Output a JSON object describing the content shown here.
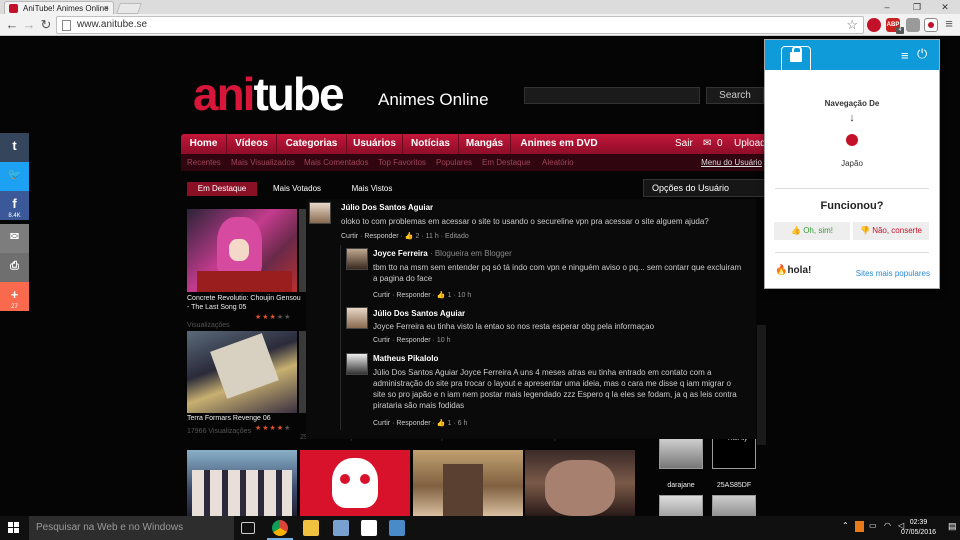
{
  "browser": {
    "tab_title": "AniTube! Animes Online",
    "url": "www.anitube.se",
    "win_min": "–",
    "win_max": "❐",
    "win_close": "✕",
    "ext_abp": "ABP",
    "ext_abp_count": "4",
    "ext_hola_badge": "JP"
  },
  "site": {
    "logo_ani": "ani",
    "logo_tube": "tube",
    "logo_subtitle": "Animes Online",
    "search_button": "Search",
    "nav": [
      "Home",
      "Vídeos",
      "Categorias",
      "Usuários",
      "Notícias",
      "Mangás",
      "Animes em DVD"
    ],
    "nav_sair": "Sair",
    "nav_upload_count": "0",
    "nav_upload": "Upload",
    "subnav": [
      "Recentes",
      "Mais Visualizados",
      "Mais Comentados",
      "Top Favoritos",
      "Populares",
      "Em Destaque",
      "Aleatório"
    ],
    "subnav_right": "Menu do Usuário",
    "filter_tabs": [
      "Em Destaque",
      "Mais Votados",
      "Mais Vistos"
    ],
    "options_title": "Opções do Usuário",
    "videos": [
      {
        "title": "Concrete Revolutio: Choujin Gensou - The Last Song 05",
        "views": "Visualizações",
        "rating": 3
      },
      {
        "title": "Terra Formars Revenge 06",
        "views": "17966 Visualizações",
        "rating": 4
      },
      {
        "title": "",
        "views": "29689 Visualizações",
        "rating": 5
      },
      {
        "title": "",
        "views": "Visualizações",
        "rating": 0
      }
    ],
    "side_users": [
      {
        "name": "darajane"
      },
      {
        "name": "25AS85DF"
      }
    ],
    "side_thumb_label": "ThePify"
  },
  "comments": [
    {
      "name": "Júlio Dos Santos Aguiar",
      "tag": "",
      "text": "oloko to com problemas em acessar o site to usando o secureline vpn pra acessar o site alguem ajuda?",
      "like": "Curtir",
      "reply": "Responder",
      "likes": "2",
      "time": "11 h",
      "edited": "Editado"
    },
    {
      "name": "Joyce Ferreira",
      "tag": "Blogueira em Blogger",
      "text": "tbm tto na msm sem entender pq só tá indo com vpn e ninguém aviso o pq... sem contarr que excluiram a pagina do face",
      "like": "Curtir",
      "reply": "Responder",
      "likes": "1",
      "time": "10 h"
    },
    {
      "name": "Júlio Dos Santos Aguiar",
      "tag": "",
      "text": "Joyce Ferreira eu tinha visto la entao so nos resta esperar obg pela informaçao",
      "like": "Curtir",
      "reply": "Responder",
      "likes": "",
      "time": "10 h"
    },
    {
      "name": "Matheus Pikalolo",
      "tag": "",
      "text": "Júlio Dos Santos Aguiar Joyce Ferreira A uns 4 meses atras eu tinha entrado em contato com a administração do site pra trocar o layout e apresentar uma ideia, mas o cara me disse q iam migrar o site so pro japão e n iam nem postar mais legendado zzz Espero q la eles se fodam, ja q as leis contra pirataria são mais fodidas",
      "like": "Curtir",
      "reply": "Responder",
      "likes": "1",
      "time": "6 h"
    }
  ],
  "hola": {
    "nav_label": "Navegação De",
    "arrow": "↓",
    "country": "Japão",
    "question": "Funcionou?",
    "yes": "Oh, sim!",
    "no": "Não, conserte",
    "brand": "hola!",
    "popular": "Sites mais populares"
  },
  "share": [
    {
      "icon": "t",
      "count": "",
      "color": "#35465c"
    },
    {
      "icon": "🐦",
      "count": "",
      "color": "#1da1f2"
    },
    {
      "icon": "f",
      "count": "8.4K",
      "color": "#3b5998"
    },
    {
      "icon": "✉",
      "count": "",
      "color": "#7d7d7d"
    },
    {
      "icon": "⎙",
      "count": "",
      "color": "#6f6f6f"
    },
    {
      "icon": "+",
      "count": "27",
      "color": "#f8694d"
    }
  ],
  "taskbar": {
    "search_placeholder": "Pesquisar na Web e no Windows",
    "time": "02:39",
    "date": "07/05/2016"
  },
  "colors": {
    "accent_red": "#c4163a",
    "hola_blue": "#0f9bd9"
  }
}
